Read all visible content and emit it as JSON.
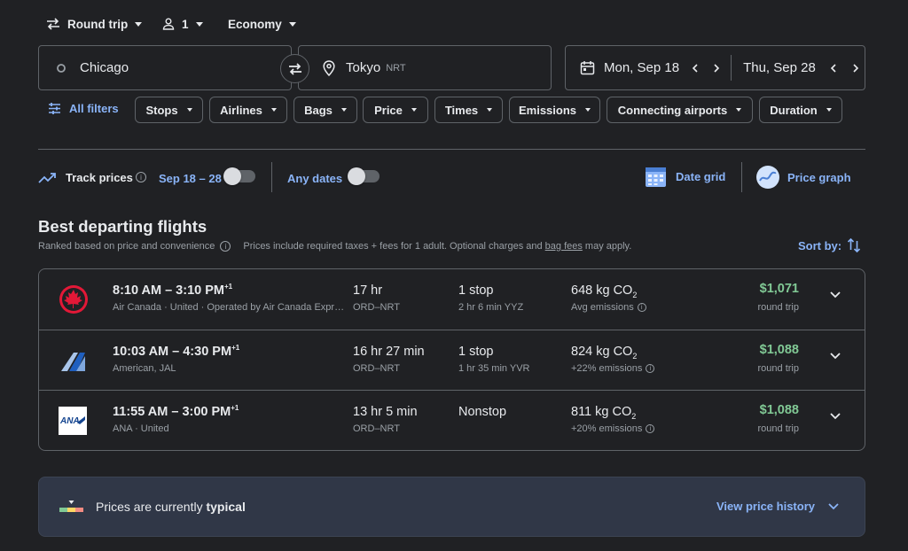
{
  "search": {
    "trip_type": "Round trip",
    "passengers": "1",
    "cabin": "Economy",
    "origin": "Chicago",
    "destination": "Tokyo",
    "destination_code": "NRT",
    "depart_date": "Mon, Sep 18",
    "return_date": "Thu, Sep 28"
  },
  "filters": {
    "all_filters": "All filters",
    "chips": [
      "Stops",
      "Airlines",
      "Bags",
      "Price",
      "Times",
      "Emissions",
      "Connecting airports",
      "Duration"
    ]
  },
  "tracking": {
    "track_prices": "Track prices",
    "date_range": "Sep 18 – 28",
    "any_dates": "Any dates",
    "date_grid": "Date grid",
    "price_graph": "Price graph"
  },
  "results": {
    "title": "Best departing flights",
    "ranked": "Ranked based on price and convenience",
    "prices_note_prefix": "Prices include required taxes + fees for 1 adult. Optional charges and ",
    "bag_fees": "bag fees",
    "prices_note_suffix": " may apply.",
    "sort_by": "Sort by:"
  },
  "flights": [
    {
      "times": "8:10 AM – 3:10 PM",
      "day_offset": "+1",
      "airlines": "Air Canada · United · Operated by Air Canada Expr…",
      "duration": "17 hr",
      "route": "ORD–NRT",
      "stops": "1 stop",
      "layover": "2 hr 6 min YYZ",
      "co2": "648 kg CO",
      "co2_sub": "2",
      "emissions": "Avg emissions",
      "price": "$1,071",
      "price_type": "round trip",
      "logo": "air-canada-logo"
    },
    {
      "times": "10:03 AM – 4:30 PM",
      "day_offset": "+1",
      "airlines": "American, JAL",
      "duration": "16 hr 27 min",
      "route": "ORD–NRT",
      "stops": "1 stop",
      "layover": "1 hr 35 min YVR",
      "co2": "824 kg CO",
      "co2_sub": "2",
      "emissions": "+22% emissions",
      "price": "$1,088",
      "price_type": "round trip",
      "logo": "american-jal-logo"
    },
    {
      "times": "11:55 AM – 3:00 PM",
      "day_offset": "+1",
      "airlines": "ANA · United",
      "duration": "13 hr 5 min",
      "route": "ORD–NRT",
      "stops": "Nonstop",
      "layover": "",
      "co2": "811 kg CO",
      "co2_sub": "2",
      "emissions": "+20% emissions",
      "price": "$1,088",
      "price_type": "round trip",
      "logo": "ana-logo"
    }
  ],
  "insights": {
    "prefix": "Prices are currently ",
    "status": "typical",
    "view_history": "View price history"
  },
  "colors": {
    "background": "#202124",
    "accent": "#8ab4f8",
    "price_green": "#81c995",
    "border": "#5f6368"
  }
}
